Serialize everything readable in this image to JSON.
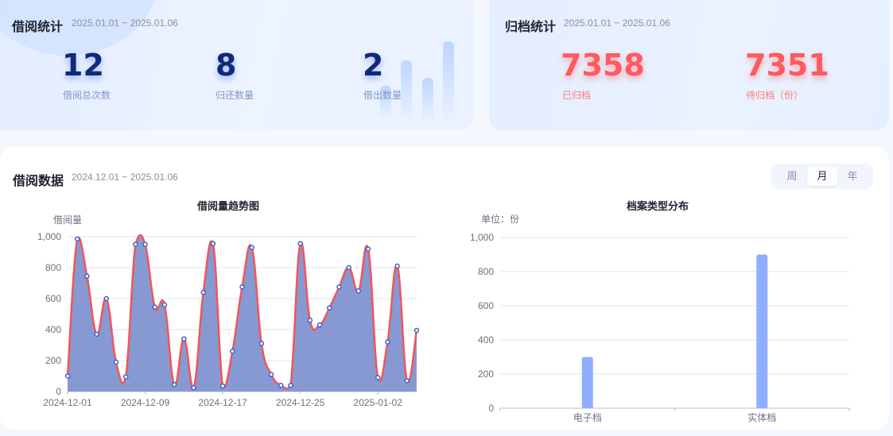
{
  "borrow_stats": {
    "title": "借阅统计",
    "range": "2025.01.01 ~ 2025.01.06",
    "items": [
      {
        "value": "12",
        "label": "借阅总次数"
      },
      {
        "value": "8",
        "label": "归还数量"
      },
      {
        "value": "2",
        "label": "借出数量"
      }
    ]
  },
  "archive_stats": {
    "title": "归档统计",
    "range": "2025.01.01 ~ 2025.01.06",
    "items": [
      {
        "value": "7358",
        "label": "已归档"
      },
      {
        "value": "7351",
        "label": "待归档（份）"
      }
    ]
  },
  "borrow_data": {
    "title": "借阅数据",
    "range": "2024.12.01 ~ 2025.01.06",
    "period_tabs": [
      "周",
      "月",
      "年"
    ],
    "active_tab": "月"
  },
  "colors": {
    "line": "#f2555a",
    "area": "#7f94d1",
    "point_fill": "#ffffff",
    "point_stroke": "#3a63c4",
    "bar": "#8faeff"
  },
  "chart_data": [
    {
      "type": "area",
      "title": "借阅量趋势图",
      "ylabel": "借阅量",
      "ylim": [
        0,
        1000
      ],
      "yticks": [
        "0",
        "200",
        "400",
        "600",
        "800",
        "1,000"
      ],
      "xtick_labels": [
        "2024-12-01",
        "2024-12-09",
        "2024-12-17",
        "2024-12-25",
        "2025-01-02"
      ],
      "x": [
        "2024-12-01",
        "2024-12-02",
        "2024-12-03",
        "2024-12-04",
        "2024-12-05",
        "2024-12-06",
        "2024-12-07",
        "2024-12-08",
        "2024-12-09",
        "2024-12-10",
        "2024-12-11",
        "2024-12-12",
        "2024-12-13",
        "2024-12-14",
        "2024-12-15",
        "2024-12-16",
        "2024-12-17",
        "2024-12-18",
        "2024-12-19",
        "2024-12-20",
        "2024-12-21",
        "2024-12-22",
        "2024-12-23",
        "2024-12-24",
        "2024-12-25",
        "2024-12-26",
        "2024-12-27",
        "2024-12-28",
        "2024-12-29",
        "2024-12-30",
        "2024-12-31",
        "2025-01-01",
        "2025-01-02",
        "2025-01-03",
        "2025-01-04",
        "2025-01-05",
        "2025-01-06"
      ],
      "values": [
        100,
        985,
        745,
        370,
        600,
        190,
        95,
        950,
        950,
        545,
        560,
        45,
        340,
        25,
        640,
        955,
        35,
        260,
        675,
        930,
        310,
        110,
        40,
        40,
        955,
        460,
        430,
        540,
        675,
        800,
        650,
        920,
        90,
        320,
        810,
        70,
        395
      ],
      "grid": true
    },
    {
      "type": "bar",
      "title": "档案类型分布",
      "ylabel": "单位：份",
      "ylim": [
        0,
        1000
      ],
      "yticks": [
        "0",
        "200",
        "400",
        "600",
        "800",
        "1,000"
      ],
      "categories": [
        "电子档",
        "实体档"
      ],
      "values": [
        300,
        900
      ],
      "grid": true
    }
  ]
}
